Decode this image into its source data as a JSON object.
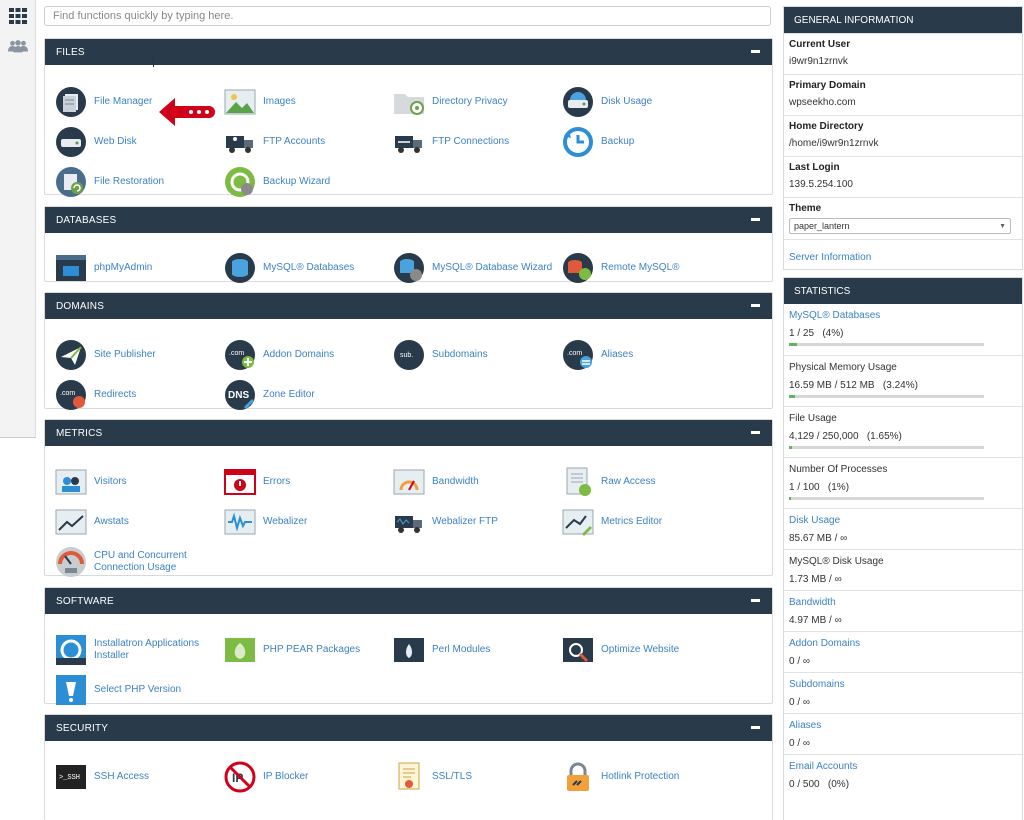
{
  "search": {
    "placeholder": "Find functions quickly by typing here."
  },
  "rail": {
    "grid_icon": "grid-icon",
    "users_icon": "users-icon"
  },
  "sections": {
    "files": {
      "title": "FILES",
      "items": [
        {
          "label": "File Manager",
          "icon": "file-manager-icon"
        },
        {
          "label": "Images",
          "icon": "images-icon"
        },
        {
          "label": "Directory Privacy",
          "icon": "folder-privacy-icon"
        },
        {
          "label": "Disk Usage",
          "icon": "disk-usage-icon"
        },
        {
          "label": "Web Disk",
          "icon": "web-disk-icon"
        },
        {
          "label": "FTP Accounts",
          "icon": "ftp-accounts-icon"
        },
        {
          "label": "FTP Connections",
          "icon": "ftp-connections-icon"
        },
        {
          "label": "Backup",
          "icon": "backup-icon"
        },
        {
          "label": "File Restoration",
          "icon": "file-restoration-icon"
        },
        {
          "label": "Backup Wizard",
          "icon": "backup-wizard-icon"
        }
      ]
    },
    "databases": {
      "title": "DATABASES",
      "items": [
        {
          "label": "phpMyAdmin",
          "icon": "phpmyadmin-icon"
        },
        {
          "label": "MySQL® Databases",
          "icon": "mysql-databases-icon"
        },
        {
          "label": "MySQL® Database Wizard",
          "icon": "mysql-wizard-icon"
        },
        {
          "label": "Remote MySQL®",
          "icon": "remote-mysql-icon"
        }
      ]
    },
    "domains": {
      "title": "DOMAINS",
      "items": [
        {
          "label": "Site Publisher",
          "icon": "site-publisher-icon"
        },
        {
          "label": "Addon Domains",
          "icon": "addon-domains-icon"
        },
        {
          "label": "Subdomains",
          "icon": "subdomains-icon"
        },
        {
          "label": "Aliases",
          "icon": "aliases-icon"
        },
        {
          "label": "Redirects",
          "icon": "redirects-icon"
        },
        {
          "label": "Zone Editor",
          "icon": "zone-editor-icon"
        }
      ]
    },
    "metrics": {
      "title": "METRICS",
      "items": [
        {
          "label": "Visitors",
          "icon": "visitors-icon"
        },
        {
          "label": "Errors",
          "icon": "errors-icon"
        },
        {
          "label": "Bandwidth",
          "icon": "bandwidth-icon"
        },
        {
          "label": "Raw Access",
          "icon": "raw-access-icon"
        },
        {
          "label": "Awstats",
          "icon": "awstats-icon"
        },
        {
          "label": "Webalizer",
          "icon": "webalizer-icon"
        },
        {
          "label": "Webalizer FTP",
          "icon": "webalizer-ftp-icon"
        },
        {
          "label": "Metrics Editor",
          "icon": "metrics-editor-icon"
        },
        {
          "label": "CPU and Concurrent\nConnection Usage",
          "icon": "cpu-usage-icon"
        }
      ]
    },
    "software": {
      "title": "SOFTWARE",
      "items": [
        {
          "label": "Installatron Applications\nInstaller",
          "icon": "installatron-icon"
        },
        {
          "label": "PHP PEAR Packages",
          "icon": "php-pear-icon"
        },
        {
          "label": "Perl Modules",
          "icon": "perl-modules-icon"
        },
        {
          "label": "Optimize Website",
          "icon": "optimize-website-icon"
        },
        {
          "label": "Select PHP Version",
          "icon": "select-php-icon"
        }
      ]
    },
    "security": {
      "title": "SECURITY",
      "items": [
        {
          "label": "SSH Access",
          "icon": "ssh-access-icon"
        },
        {
          "label": "IP Blocker",
          "icon": "ip-blocker-icon"
        },
        {
          "label": "SSL/TLS",
          "icon": "ssl-tls-icon"
        },
        {
          "label": "Hotlink Protection",
          "icon": "hotlink-protection-icon"
        }
      ]
    }
  },
  "general_info": {
    "title": "GENERAL INFORMATION",
    "current_user_label": "Current User",
    "current_user": "i9wr9n1zrnvk",
    "primary_domain_label": "Primary Domain",
    "primary_domain": "wpseekho.com",
    "home_directory_label": "Home Directory",
    "home_directory": "/home/i9wr9n1zrnvk",
    "last_login_label": "Last Login",
    "last_login": "139.5.254.100",
    "theme_label": "Theme",
    "theme_value": "paper_lantern",
    "server_info_link": "Server Information"
  },
  "statistics": {
    "title": "STATISTICS",
    "rows": [
      {
        "label": "MySQL® Databases",
        "value": "1 / 25   (4%)",
        "link": true,
        "percent": 4
      },
      {
        "label": "Physical Memory Usage",
        "value": "16.59 MB / 512 MB   (3.24%)",
        "link": false,
        "percent": 3.24
      },
      {
        "label": "File Usage",
        "value": "4,129 / 250,000   (1.65%)",
        "link": false,
        "percent": 1.65
      },
      {
        "label": "Number Of Processes",
        "value": "1 / 100   (1%)",
        "link": false,
        "percent": 1
      },
      {
        "label": "Disk Usage",
        "value": "85.67 MB / ∞",
        "link": true
      },
      {
        "label": "MySQL® Disk Usage",
        "value": "1.73 MB / ∞",
        "link": false
      },
      {
        "label": "Bandwidth",
        "value": "4.97 MB / ∞",
        "link": true
      },
      {
        "label": "Addon Domains",
        "value": "0 / ∞",
        "link": true
      },
      {
        "label": "Subdomains",
        "value": "0 / ∞",
        "link": true
      },
      {
        "label": "Aliases",
        "value": "0 / ∞",
        "link": true
      },
      {
        "label": "Email Accounts",
        "value": "0 / 500   (0%)",
        "link": true
      }
    ]
  },
  "colors": {
    "header_bg": "#293a4a",
    "link": "#3d82c3",
    "bar_fill": "#5cb85c",
    "arrow": "#d0021b"
  }
}
